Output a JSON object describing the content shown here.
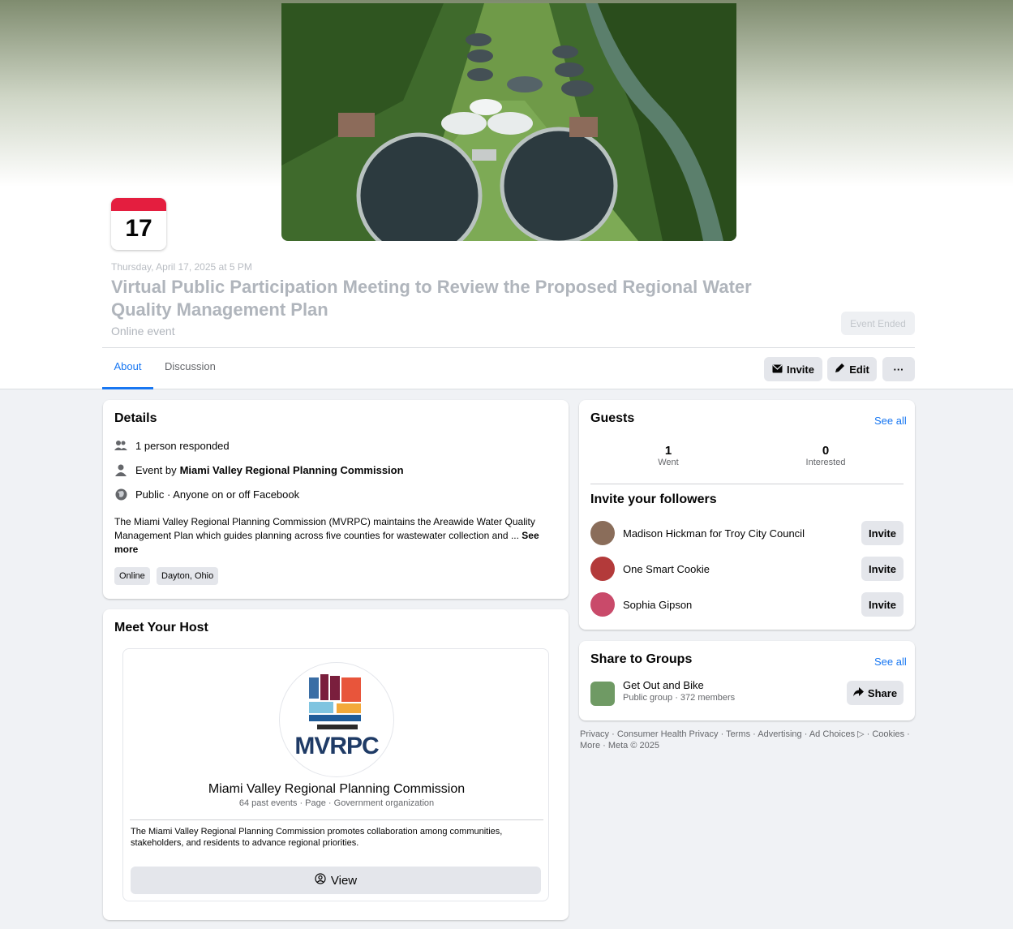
{
  "event": {
    "day": "17",
    "date_text": "Thursday, April 17, 2025 at 5 PM",
    "title": "Virtual Public Participation Meeting to Review the Proposed Regional Water Quality Management Plan",
    "subtitle": "Online event",
    "status_button": "Event Ended"
  },
  "tabs": [
    {
      "label": "About",
      "active": true
    },
    {
      "label": "Discussion",
      "active": false
    }
  ],
  "actions": {
    "invite": "Invite",
    "edit": "Edit",
    "more": "···"
  },
  "details": {
    "title": "Details",
    "responded": "1 person responded",
    "event_by_prefix": "Event by",
    "event_by_name": "Miami Valley Regional Planning Commission",
    "privacy": "Public · Anyone on or off Facebook",
    "description": "The Miami Valley Regional Planning Commission (MVRPC) maintains the Areawide Water Quality Management Plan which guides planning across five counties for wastewater collection and ...",
    "see_more": "See more",
    "tags": [
      "Online",
      "Dayton, Ohio"
    ]
  },
  "host": {
    "title": "Meet Your Host",
    "logo_text": "MVRPC",
    "name": "Miami Valley Regional Planning Commission",
    "meta": "64 past events · Page · Government organization",
    "description": "The Miami Valley Regional Planning Commission promotes collaboration among communities, stakeholders, and residents to advance regional priorities.",
    "view_button": "View"
  },
  "guests": {
    "title": "Guests",
    "see_all": "See all",
    "went_count": "1",
    "went_label": "Went",
    "interested_count": "0",
    "interested_label": "Interested"
  },
  "invite_followers": {
    "title": "Invite your followers",
    "button_label": "Invite",
    "people": [
      {
        "name": "Madison Hickman for Troy City Council",
        "avatar_color": "#8a6d5a"
      },
      {
        "name": "One Smart Cookie",
        "avatar_color": "#b33a3a"
      },
      {
        "name": "Sophia Gipson",
        "avatar_color": "#c94a6a"
      }
    ]
  },
  "share_groups": {
    "title": "Share to Groups",
    "see_all": "See all",
    "group_name": "Get Out and Bike",
    "group_meta": "Public group · 372 members",
    "share_button": "Share"
  },
  "footer": {
    "text": "Privacy · Consumer Health Privacy · Terms · Advertising · Ad Choices ▷ · Cookies · More · Meta © 2025"
  },
  "colors": {
    "accent": "#1877f2",
    "calendar_red": "#e41e3f",
    "page_bg": "#f0f2f5"
  }
}
